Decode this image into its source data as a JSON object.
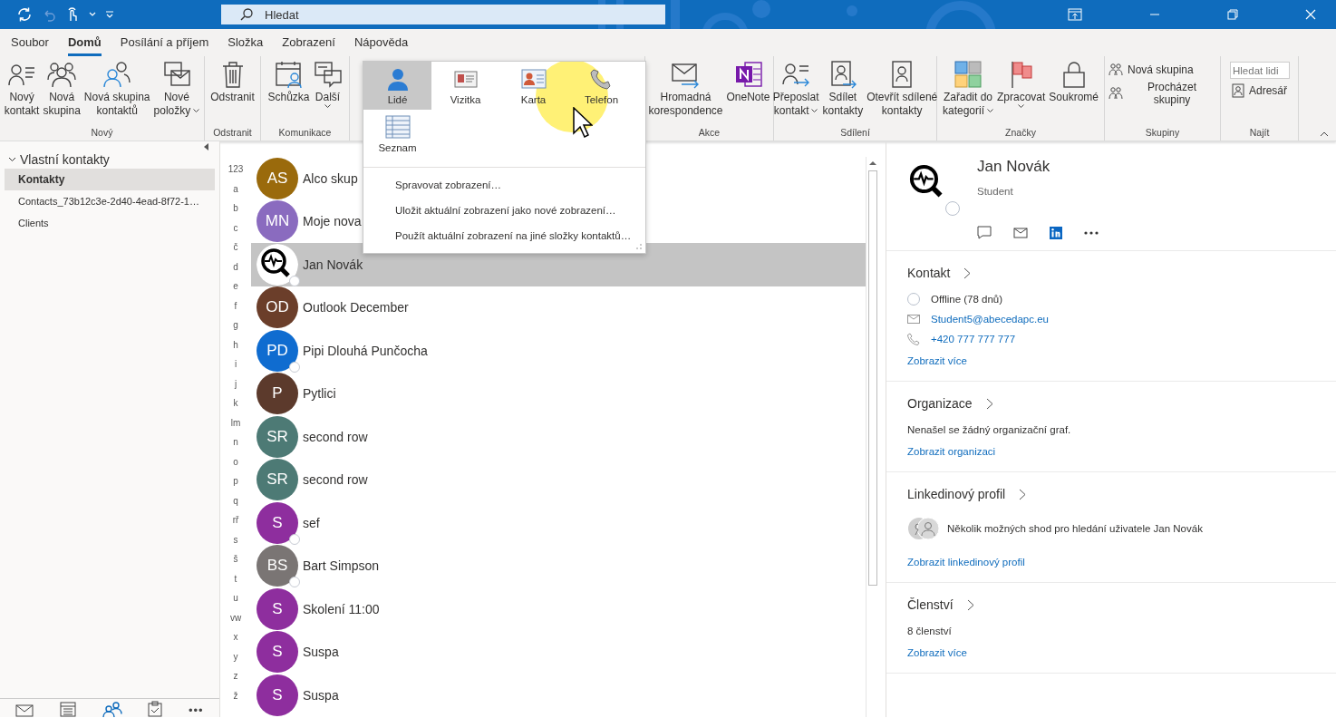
{
  "title_bar": {
    "search": {
      "placeholder": "Hledat"
    }
  },
  "menu_tabs": [
    {
      "label": "Soubor",
      "selected": false
    },
    {
      "label": "Domů",
      "selected": true
    },
    {
      "label": "Posílání a příjem",
      "selected": false
    },
    {
      "label": "Složka",
      "selected": false
    },
    {
      "label": "Zobrazení",
      "selected": false
    },
    {
      "label": "Nápověda",
      "selected": false
    }
  ],
  "ribbon": {
    "groups": [
      {
        "label": "Nový",
        "buttons": [
          {
            "kind": "large",
            "lines": [
              "Nový",
              "kontakt"
            ],
            "dropdown": false
          },
          {
            "kind": "large",
            "lines": [
              "Nová",
              "skupina"
            ],
            "dropdown": false
          },
          {
            "kind": "large",
            "lines": [
              "Nová skupina",
              "kontaktů"
            ],
            "dropdown": false
          },
          {
            "kind": "large",
            "lines": [
              "Nové",
              "položky"
            ],
            "dropdown": true
          }
        ]
      },
      {
        "label": "Odstranit",
        "buttons": [
          {
            "kind": "large",
            "lines": [
              "Odstranit"
            ],
            "dropdown": false
          }
        ]
      },
      {
        "label": "Komunikace",
        "buttons": [
          {
            "kind": "large",
            "lines": [
              "Schůzka"
            ],
            "dropdown": false
          },
          {
            "kind": "large",
            "lines": [
              "Další"
            ],
            "dropdown": true
          }
        ]
      },
      {
        "label": "Akce",
        "buttons": [
          {
            "kind": "large",
            "lines": [
              "Hromadná",
              "korespondence"
            ],
            "dropdown": false
          },
          {
            "kind": "large",
            "lines": [
              "OneNote"
            ],
            "dropdown": false
          }
        ]
      },
      {
        "label": "Sdílení",
        "buttons": [
          {
            "kind": "large",
            "lines": [
              "Přeposlat",
              "kontakt"
            ],
            "dropdown": true
          },
          {
            "kind": "large",
            "lines": [
              "Sdílet",
              "kontakty"
            ],
            "dropdown": false
          },
          {
            "kind": "large",
            "lines": [
              "Otevřít sdílené",
              "kontakty"
            ],
            "dropdown": false
          }
        ]
      },
      {
        "label": "Značky",
        "buttons": [
          {
            "kind": "large",
            "lines": [
              "Zařadit do",
              "kategorií"
            ],
            "dropdown": true
          },
          {
            "kind": "large",
            "lines": [
              "Zpracovat"
            ],
            "dropdown": true
          },
          {
            "kind": "large",
            "lines": [
              "Soukromé"
            ],
            "dropdown": false
          }
        ]
      },
      {
        "label": "Skupiny",
        "buttons": [
          {
            "kind": "small",
            "lines": [
              "Nová skupina"
            ],
            "dropdown": false
          },
          {
            "kind": "small",
            "lines": [
              "Procházet skupiny"
            ],
            "dropdown": false
          }
        ]
      },
      {
        "label": "Najít",
        "buttons": [
          {
            "kind": "field",
            "placeholder": "Hledat lidi"
          },
          {
            "kind": "small",
            "lines": [
              "Adresář"
            ],
            "dropdown": false
          }
        ]
      }
    ]
  },
  "view_popup": {
    "views": [
      {
        "label": "Lidé",
        "selected": true
      },
      {
        "label": "Vizitka",
        "selected": false
      },
      {
        "label": "Karta",
        "selected": false
      },
      {
        "label": "Telefon",
        "selected": false
      },
      {
        "label": "Seznam",
        "selected": false
      }
    ],
    "commands": [
      "Spravovat zobrazení…",
      "Uložit aktuální zobrazení jako nové zobrazení…",
      "Použít aktuální zobrazení na jiné složky kontaktů…"
    ]
  },
  "sidebar": {
    "items": [
      {
        "label": "Vlastní kontakty",
        "expanded": true,
        "children": [
          {
            "label": "Kontakty",
            "selected": true
          },
          {
            "label": "Contacts_73b12c3e-2d40-4ead-8f72-1…",
            "selected": false
          },
          {
            "label": "Clients",
            "selected": false
          }
        ]
      }
    ],
    "modules": [
      {
        "kind": "mail",
        "selected": false
      },
      {
        "kind": "calendar",
        "selected": false
      },
      {
        "kind": "people",
        "selected": true
      },
      {
        "kind": "tasks",
        "selected": false
      },
      {
        "kind": "more",
        "label": "•••",
        "selected": false
      }
    ]
  },
  "index_letters": [
    "123",
    "a",
    "b",
    "c",
    "č",
    "d",
    "e",
    "f",
    "g",
    "h",
    "i",
    "j",
    "k",
    "lm",
    "n",
    "o",
    "p",
    "q",
    "rř",
    "s",
    "š",
    "t",
    "u",
    "vw",
    "x",
    "y",
    "z",
    "ž"
  ],
  "contacts": [
    {
      "kind": "initials",
      "initials": "AS",
      "color": "#9a6a0c",
      "name": "Alco skup",
      "presence": false,
      "selected": false
    },
    {
      "kind": "initials",
      "initials": "MN",
      "color": "#8a6bbf",
      "name": "Moje nova",
      "presence": false,
      "selected": false
    },
    {
      "kind": "logo",
      "name": "Jan Novák",
      "presence": true,
      "selected": true
    },
    {
      "kind": "initials",
      "initials": "OD",
      "color": "#6b3e2a",
      "name": "Outlook December",
      "presence": false,
      "selected": false
    },
    {
      "kind": "initials",
      "initials": "PD",
      "color": "#0f6cd0",
      "name": "Pipi Dlouhá Punčocha",
      "presence": true,
      "selected": false
    },
    {
      "kind": "initials",
      "initials": "P",
      "color": "#5c3a2c",
      "name": "Pytlici",
      "presence": false,
      "selected": false
    },
    {
      "kind": "initials",
      "initials": "SR",
      "color": "#4d7a75",
      "name": "second row",
      "presence": false,
      "selected": false
    },
    {
      "kind": "initials",
      "initials": "SR",
      "color": "#4d7a75",
      "name": "second row",
      "presence": false,
      "selected": false
    },
    {
      "kind": "initials",
      "initials": "S",
      "color": "#8e2e9e",
      "name": "sef",
      "presence": true,
      "selected": false
    },
    {
      "kind": "initials",
      "initials": "BS",
      "color": "#7a7574",
      "name": "Bart Simpson",
      "presence": true,
      "selected": false
    },
    {
      "kind": "initials",
      "initials": "S",
      "color": "#8e2e9e",
      "name": "Skolení 11:00",
      "presence": false,
      "selected": false
    },
    {
      "kind": "initials",
      "initials": "S",
      "color": "#8e2e9e",
      "name": "Suspa",
      "presence": false,
      "selected": false
    },
    {
      "kind": "initials",
      "initials": "S",
      "color": "#8e2e9e",
      "name": "Suspa",
      "presence": false,
      "selected": false
    }
  ],
  "detail": {
    "name": "Jan Novák",
    "subtitle": "Student",
    "presence": true,
    "sections": [
      {
        "title": "Kontakt",
        "items": [
          {
            "kind": "status",
            "text": "Offline (78 dnů)"
          },
          {
            "kind": "email",
            "text": "Student5@abecedapc.eu"
          },
          {
            "kind": "phone",
            "text": "+420 777 777 777"
          }
        ],
        "link": "Zobrazit více"
      },
      {
        "title": "Organizace",
        "items": [
          {
            "kind": "text",
            "text": "Nenašel se žádný organizační graf."
          }
        ],
        "link": "Zobrazit organizaci"
      },
      {
        "title": "Linkedinový profil",
        "items": [
          {
            "kind": "people",
            "text": "Několik možných shod pro hledání uživatele Jan Novák"
          }
        ],
        "link": "Zobrazit linkedinový profil"
      },
      {
        "title": "Členství",
        "items": [
          {
            "kind": "text",
            "text": "8 členství"
          }
        ],
        "link": "Zobrazit více"
      }
    ]
  }
}
